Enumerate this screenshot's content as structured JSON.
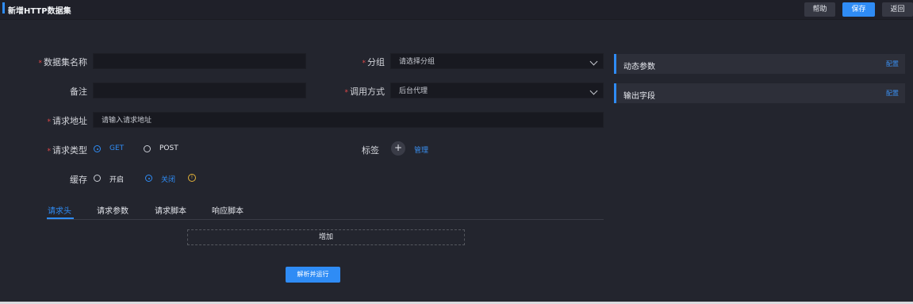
{
  "header": {
    "title": "新增HTTP数据集",
    "help_label": "帮助",
    "save_label": "保存",
    "back_label": "返回"
  },
  "form": {
    "dataset_name": {
      "label": "数据集名称",
      "value": ""
    },
    "group": {
      "label": "分组",
      "placeholder": "请选择分组"
    },
    "remark": {
      "label": "备注",
      "value": ""
    },
    "call_mode": {
      "label": "调用方式",
      "value": "后台代理"
    },
    "request_url": {
      "label": "请求地址",
      "placeholder": "请输入请求地址"
    },
    "request_type": {
      "label": "请求类型",
      "options": [
        "GET",
        "POST"
      ],
      "selected": "GET"
    },
    "tags": {
      "label": "标签",
      "manage_label": "管理"
    },
    "cache": {
      "label": "缓存",
      "options": [
        "开启",
        "关闭"
      ],
      "selected": "关闭"
    }
  },
  "tabs": [
    "请求头",
    "请求参数",
    "请求脚本",
    "响应脚本"
  ],
  "active_tab": "请求头",
  "add_label": "增加",
  "run_label": "解析并运行",
  "side_panels": [
    {
      "title": "动态参数",
      "action": "配置"
    },
    {
      "title": "输出字段",
      "action": "配置"
    }
  ],
  "colors": {
    "accent": "#2f8cf5",
    "required": "#e04848",
    "background": "#23252e"
  },
  "icons": {
    "add": "plus-icon",
    "select": "chevron-down-icon",
    "info": "info-icon"
  }
}
